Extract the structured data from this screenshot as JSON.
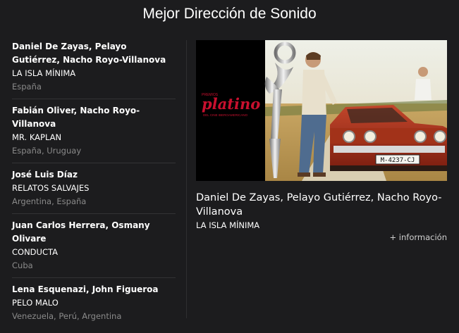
{
  "page": {
    "title": "Mejor Dirección de Sonido"
  },
  "nominees": [
    {
      "names": "Daniel De Zayas, Pelayo Gutiérrez, Nacho Royo-Villanova",
      "film": "LA ISLA MÍNIMA",
      "country": "España"
    },
    {
      "names": "Fabián Oliver, Nacho Royo-Villanova",
      "film": "MR. KAPLAN",
      "country": "España, Uruguay"
    },
    {
      "names": "José Luis Díaz",
      "film": "RELATOS SALVAJES",
      "country": "Argentina, España"
    },
    {
      "names": "Juan Carlos Herrera, Osmany Olivare",
      "film": "CONDUCTA",
      "country": "Cuba"
    },
    {
      "names": "Lena Esquenazi, John Figueroa",
      "film": "PELO MALO",
      "country": "Venezuela, Perú, Argentina"
    }
  ],
  "featured": {
    "names": "Daniel De Zayas, Pelayo Gutiérrez, Nacho Royo-Villanova",
    "film": "LA ISLA MÍNIMA",
    "more_info_label": "+ información",
    "image": {
      "logo_small_text": "PREMIOS",
      "logo_text": "platino",
      "logo_sub_text": "DEL CINE IBEROAMERICANO",
      "license_plate": "M-4237-CJ",
      "trophy_icon": "trophy-icon"
    }
  },
  "colors": {
    "background": "#1c1c1e",
    "muted_text": "#8a8a8a",
    "brand_red": "#c8102e"
  }
}
